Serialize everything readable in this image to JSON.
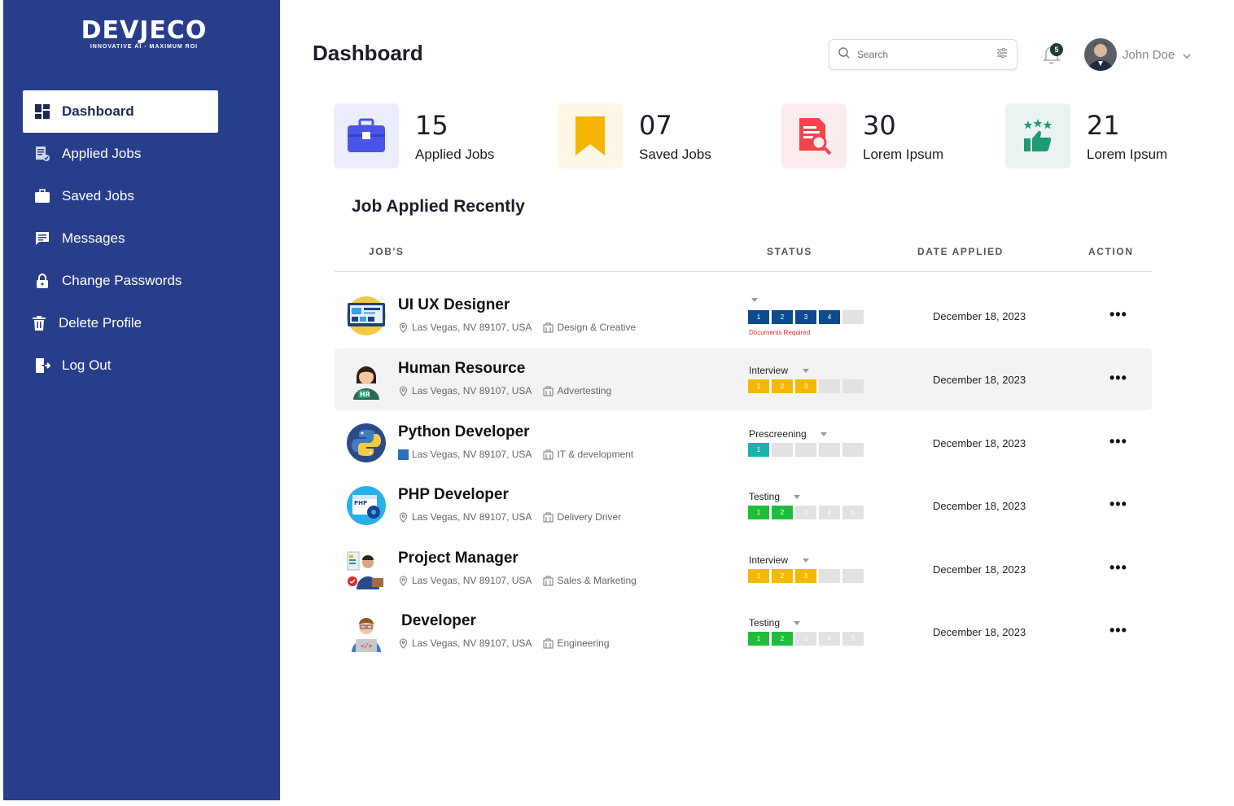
{
  "brand": {
    "name": "DEVJECO",
    "tagline": "INNOVATIVE AI - MAXIMUM ROI"
  },
  "sidebar": {
    "items": [
      {
        "label": "Dashboard",
        "icon": "dashboard-icon",
        "active": true
      },
      {
        "label": "Applied Jobs",
        "icon": "applied-jobs-icon"
      },
      {
        "label": "Saved Jobs",
        "icon": "briefcase-icon"
      },
      {
        "label": "Messages",
        "icon": "message-icon"
      },
      {
        "label": "Change Passwords",
        "icon": "lock-icon"
      },
      {
        "label": "Delete Profile",
        "icon": "trash-icon"
      },
      {
        "label": "Log Out",
        "icon": "logout-icon"
      }
    ]
  },
  "header": {
    "title": "Dashboard",
    "search_placeholder": "Search",
    "notification_count": "5",
    "user_name": "John Doe"
  },
  "stats": [
    {
      "value": "15",
      "label": "Applied Jobs",
      "icon": "briefcase-icon",
      "tile_color": "#eceefe"
    },
    {
      "value": "07",
      "label": "Saved Jobs",
      "icon": "bookmark-icon",
      "tile_color": "#fff6e6"
    },
    {
      "value": "30",
      "label": "Lorem Ipsum",
      "icon": "document-search-icon",
      "tile_color": "#fdeced"
    },
    {
      "value": "21",
      "label": "Lorem Ipsum",
      "icon": "thumbs-up-stars-icon",
      "tile_color": "#e9f4f1"
    }
  ],
  "recent": {
    "title": "Job Applied Recently",
    "columns": [
      "JOB'S",
      "STATUS",
      "DATE APPLIED",
      "ACTION"
    ],
    "rows": [
      {
        "title": "UI UX Designer",
        "location": "Las Vegas, NV 89107, USA",
        "category": "Design & Creative",
        "status": "",
        "note": "Documents Required",
        "steps": [
          {
            "t": "1",
            "c": "#0d4a8f"
          },
          {
            "t": "2",
            "c": "#0d4a8f"
          },
          {
            "t": "3",
            "c": "#0d4a8f"
          },
          {
            "t": "4",
            "c": "#0d4a8f"
          },
          {
            "t": "",
            "c": "#e2e2e2"
          }
        ],
        "date": "December 18, 2023"
      },
      {
        "title": "Human Resource",
        "location": "Las Vegas, NV 89107, USA",
        "category": "Advertesting",
        "status": "Interview",
        "note": "",
        "steps": [
          {
            "t": "1",
            "c": "#f5b800"
          },
          {
            "t": "2",
            "c": "#f5b800"
          },
          {
            "t": "3",
            "c": "#f5b800"
          },
          {
            "t": "",
            "c": "#e2e2e2"
          },
          {
            "t": "",
            "c": "#e2e2e2"
          }
        ],
        "date": "December 18, 2023"
      },
      {
        "title": "Python Developer",
        "location": "Las Vegas, NV 89107, USA",
        "category": "IT & development",
        "status": "Prescreening",
        "note": "",
        "steps": [
          {
            "t": "1",
            "c": "#19b3b0"
          },
          {
            "t": "",
            "c": "#e2e2e2"
          },
          {
            "t": "",
            "c": "#e2e2e2"
          },
          {
            "t": "",
            "c": "#e2e2e2"
          },
          {
            "t": "",
            "c": "#e2e2e2"
          }
        ],
        "date": "December 18, 2023"
      },
      {
        "title": "PHP Developer",
        "location": "Las Vegas, NV 89107, USA",
        "category": "Delivery Driver",
        "status": "Testing",
        "note": "",
        "steps": [
          {
            "t": "1",
            "c": "#1fbe3a"
          },
          {
            "t": "2",
            "c": "#1fbe3a"
          },
          {
            "t": "3",
            "c": "#e2e2e2"
          },
          {
            "t": "4",
            "c": "#e2e2e2"
          },
          {
            "t": "5",
            "c": "#e2e2e2"
          }
        ],
        "date": "December 18, 2023"
      },
      {
        "title": "Project Manager",
        "location": "Las Vegas, NV 89107, USA",
        "category": "Sales & Marketing",
        "status": "Interview",
        "note": "",
        "steps": [
          {
            "t": "1",
            "c": "#f5b800"
          },
          {
            "t": "2",
            "c": "#f5b800"
          },
          {
            "t": "3",
            "c": "#f5b800"
          },
          {
            "t": "",
            "c": "#e2e2e2"
          },
          {
            "t": "",
            "c": "#e2e2e2"
          }
        ],
        "date": "December 18, 2023"
      },
      {
        "title": "Developer",
        "location": "Las Vegas, NV 89107, USA",
        "category": "Engineering",
        "status": "Testing",
        "note": "",
        "steps": [
          {
            "t": "1",
            "c": "#1fbe3a"
          },
          {
            "t": "2",
            "c": "#1fbe3a"
          },
          {
            "t": "3",
            "c": "#e2e2e2"
          },
          {
            "t": "4",
            "c": "#e2e2e2"
          },
          {
            "t": "5",
            "c": "#e2e2e2"
          }
        ],
        "date": "December 18, 2023"
      }
    ]
  },
  "colors": {
    "sidebar": "#283e8a",
    "accent": "#4a55e8"
  }
}
